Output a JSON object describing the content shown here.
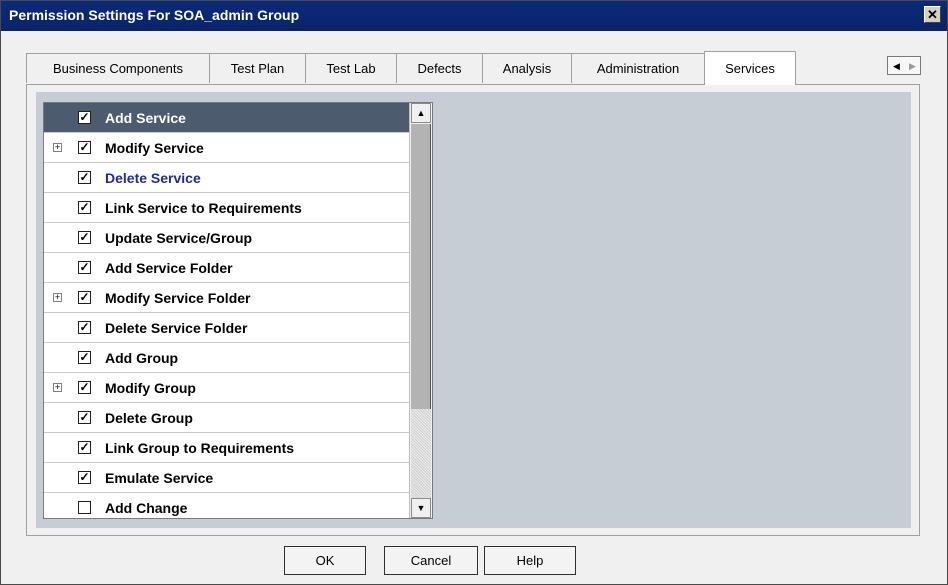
{
  "dialog": {
    "title": "Permission Settings For SOA_admin Group",
    "close_glyph": "✕"
  },
  "tabs": [
    {
      "label": "Business Components"
    },
    {
      "label": "Test Plan"
    },
    {
      "label": "Test Lab"
    },
    {
      "label": "Defects"
    },
    {
      "label": "Analysis"
    },
    {
      "label": "Administration"
    },
    {
      "label": "Services",
      "active": true
    }
  ],
  "tab_scroll": {
    "left_glyph": "◀",
    "right_glyph": "▶"
  },
  "permissions": [
    {
      "label": "Add Service",
      "checked": true,
      "expandable": false,
      "selected": true
    },
    {
      "label": "Modify Service",
      "checked": true,
      "expandable": true
    },
    {
      "label": "Delete Service",
      "checked": true,
      "expandable": false,
      "link": true
    },
    {
      "label": "Link Service to Requirements",
      "checked": true,
      "expandable": false
    },
    {
      "label": "Update Service/Group",
      "checked": true,
      "expandable": false
    },
    {
      "label": "Add Service Folder",
      "checked": true,
      "expandable": false
    },
    {
      "label": "Modify Service Folder",
      "checked": true,
      "expandable": true
    },
    {
      "label": "Delete Service Folder",
      "checked": true,
      "expandable": false
    },
    {
      "label": "Add Group",
      "checked": true,
      "expandable": false
    },
    {
      "label": "Modify Group",
      "checked": true,
      "expandable": true
    },
    {
      "label": "Delete Group",
      "checked": true,
      "expandable": false
    },
    {
      "label": "Link Group to Requirements",
      "checked": true,
      "expandable": false
    },
    {
      "label": "Emulate Service",
      "checked": true,
      "expandable": false
    },
    {
      "label": "Add Change",
      "checked": false,
      "expandable": false
    }
  ],
  "scrollbar": {
    "up_glyph": "▲",
    "down_glyph": "▼"
  },
  "buttons": {
    "ok": "OK",
    "cancel": "Cancel",
    "help": "Help"
  },
  "colors": {
    "title_bar": "#0a246a",
    "selected_row": "#4d5b6e",
    "link_text": "#1f2a9b",
    "panel_bg": "#c7cdd5"
  }
}
